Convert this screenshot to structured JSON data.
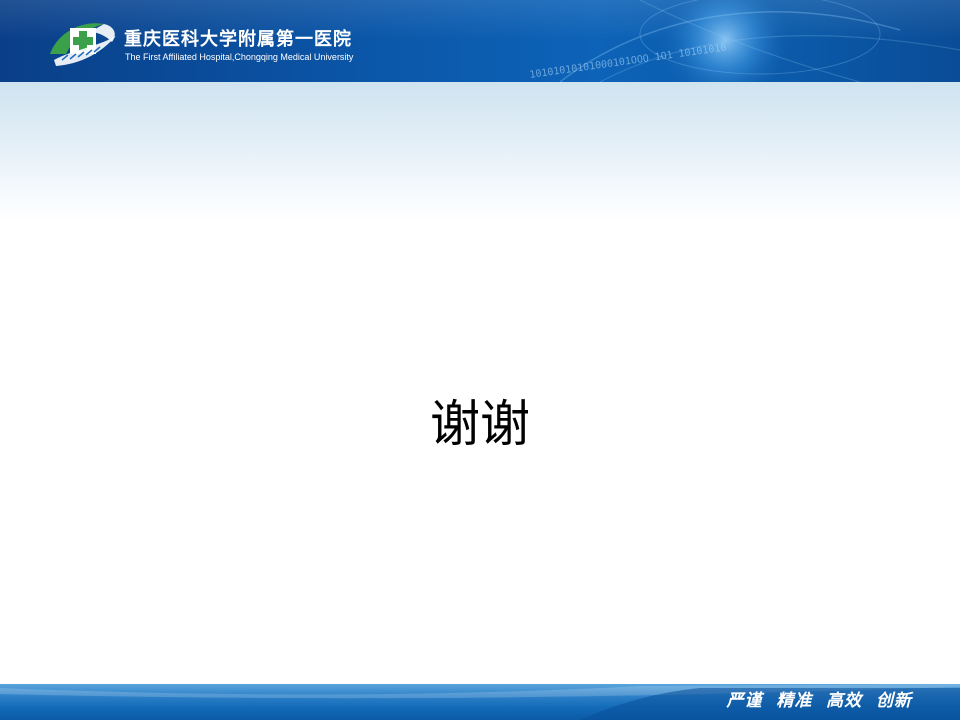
{
  "header": {
    "hospital_name_cn": "重庆医科大学附属第一医院",
    "hospital_name_en": "The First Affiliated Hospital,Chongqing Medical University",
    "binary_decoration": "10101010101000101OOO 1O1 10101010"
  },
  "main": {
    "thanks_text": "谢谢"
  },
  "footer": {
    "motto": "严谨  精准  高效  创新"
  },
  "icons": {
    "logo": "hospital-cross-logo-icon"
  },
  "colors": {
    "header_blue": "#0b56a8",
    "footer_blue": "#136bb7",
    "logo_green": "#3aa14a",
    "text": "#000000"
  }
}
